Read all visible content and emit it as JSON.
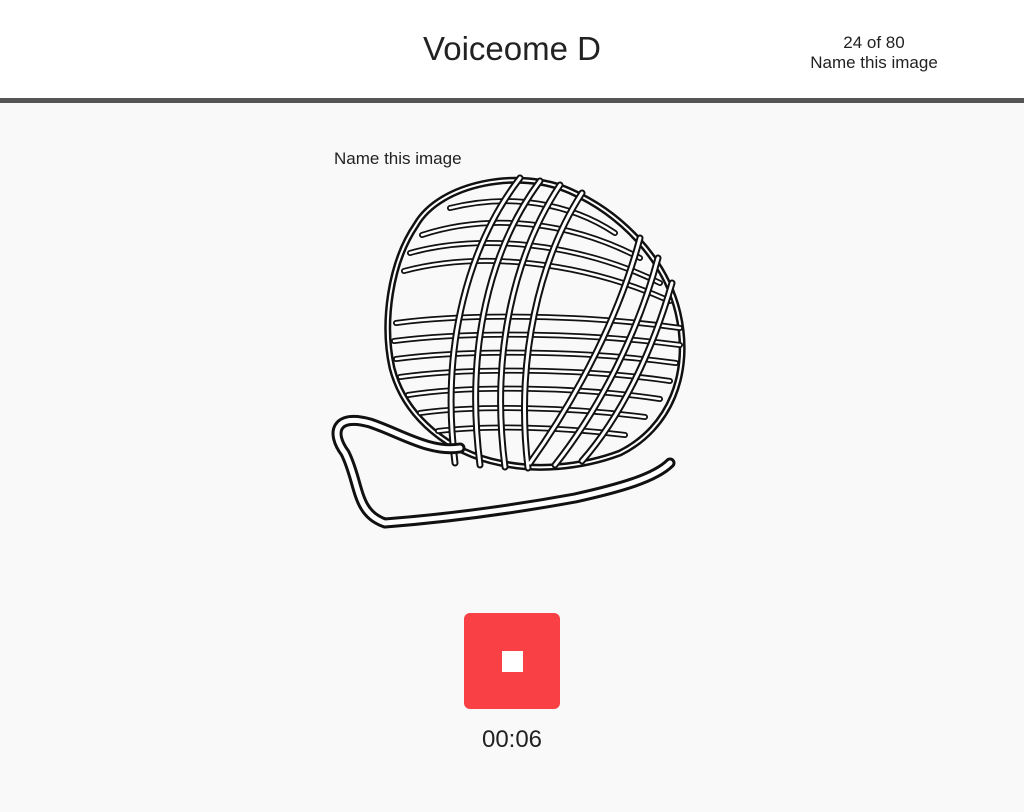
{
  "header": {
    "title": "Voiceome D",
    "progress": "24 of 80",
    "task_name": "Name this image"
  },
  "task": {
    "prompt": "Name this image",
    "image_subject": "ball-of-yarn"
  },
  "recorder": {
    "state": "recording",
    "stop_icon": "stop-icon",
    "button_color": "#f84045",
    "elapsed": "00:06"
  }
}
